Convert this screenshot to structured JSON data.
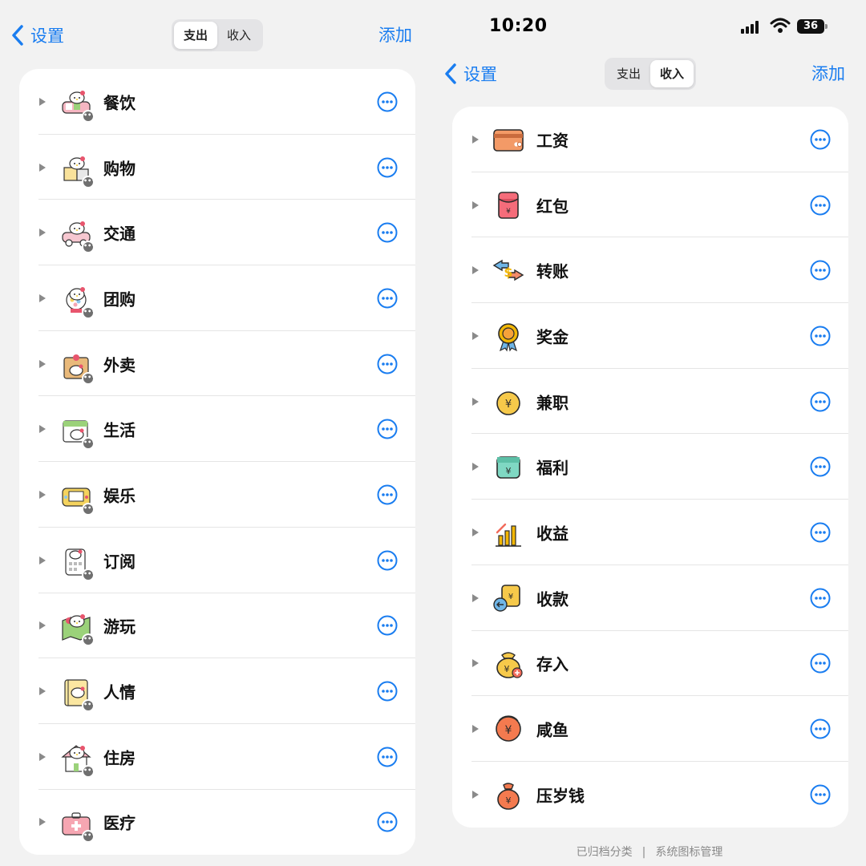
{
  "colors": {
    "accent": "#1a7df0",
    "background": "#f2f2f2",
    "card": "#ffffff"
  },
  "left": {
    "nav": {
      "back_label": "设置",
      "segments": [
        {
          "label": "支出",
          "active": true
        },
        {
          "label": "收入",
          "active": false
        }
      ],
      "add_label": "添加"
    },
    "categories": [
      {
        "label": "餐饮",
        "icon": "kitty-food-icon"
      },
      {
        "label": "购物",
        "icon": "kitty-shopping-icon"
      },
      {
        "label": "交通",
        "icon": "kitty-car-icon"
      },
      {
        "label": "团购",
        "icon": "kitty-gumball-icon"
      },
      {
        "label": "外卖",
        "icon": "kitty-takeout-bag-icon"
      },
      {
        "label": "生活",
        "icon": "kitty-calendar-icon"
      },
      {
        "label": "娱乐",
        "icon": "kitty-game-icon"
      },
      {
        "label": "订阅",
        "icon": "kitty-calculator-icon"
      },
      {
        "label": "游玩",
        "icon": "kitty-map-icon"
      },
      {
        "label": "人情",
        "icon": "kitty-notebook-icon"
      },
      {
        "label": "住房",
        "icon": "kitty-house-icon"
      },
      {
        "label": "医疗",
        "icon": "kitty-medkit-icon"
      }
    ]
  },
  "right": {
    "status_bar": {
      "time": "10:20",
      "battery": "36"
    },
    "nav": {
      "back_label": "设置",
      "segments": [
        {
          "label": "支出",
          "active": false
        },
        {
          "label": "收入",
          "active": true
        }
      ],
      "add_label": "添加"
    },
    "categories": [
      {
        "label": "工资",
        "icon": "wallet-card-icon"
      },
      {
        "label": "红包",
        "icon": "red-envelope-icon"
      },
      {
        "label": "转账",
        "icon": "transfer-icon"
      },
      {
        "label": "奖金",
        "icon": "medal-icon"
      },
      {
        "label": "兼职",
        "icon": "coin-bag-icon"
      },
      {
        "label": "福利",
        "icon": "benefit-jar-icon"
      },
      {
        "label": "收益",
        "icon": "growth-chart-icon"
      },
      {
        "label": "收款",
        "icon": "receive-payment-icon"
      },
      {
        "label": "存入",
        "icon": "money-bag-plus-icon"
      },
      {
        "label": "咸鱼",
        "icon": "exchange-coin-icon"
      },
      {
        "label": "压岁钱",
        "icon": "lucky-money-bag-icon"
      }
    ],
    "footer": {
      "archived": "已归档分类",
      "separator": "|",
      "system_icons": "系统图标管理"
    }
  }
}
